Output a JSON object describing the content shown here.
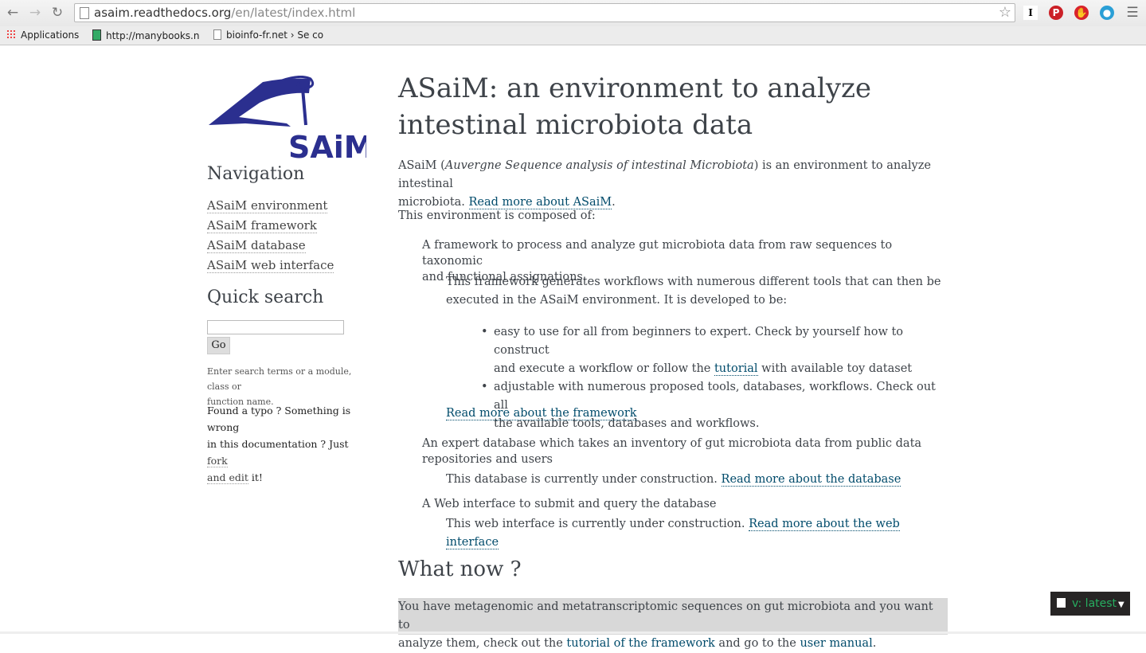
{
  "browser": {
    "url_host": "asaim.readthedocs.org",
    "url_path": "/en/latest/index.html",
    "bookmarks": [
      {
        "label": "Applications"
      },
      {
        "label": "http://manybooks.n"
      },
      {
        "label": "bioinfo-fr.net › Se co"
      }
    ]
  },
  "sidebar": {
    "logo_text": "SAiM",
    "nav_heading": "Navigation",
    "nav_items": [
      {
        "label": "ASaiM environment"
      },
      {
        "label": "ASaiM framework"
      },
      {
        "label": "ASaiM database"
      },
      {
        "label": "ASaiM web interface"
      }
    ],
    "qs_heading": "Quick search",
    "qs_input_value": "",
    "qs_button": "Go",
    "qs_help_1": "Enter search terms or a module, class or",
    "qs_help_2": "function name.",
    "typo_1": "Found a typo ? Something is wrong",
    "typo_2a": "in this documentation ? Just ",
    "typo_link_a": "fork",
    "typo_link_b": "and edit",
    "typo_end": " it!"
  },
  "main": {
    "title_1": "ASaiM: an environment to analyze",
    "title_2": "intestinal microbiota data",
    "intro_a": "ASaiM (",
    "intro_em": "Auvergne Sequence analysis of intestinal Microbiota",
    "intro_b": ") is an environment to analyze intestinal",
    "intro_c": "microbiota. ",
    "intro_link": "Read more about ASaiM",
    "intro_end": ".",
    "composed": "This environment is composed of:",
    "fw_term_1": "A framework to process and analyze gut microbiota data from raw sequences to taxonomic",
    "fw_term_2": "and functional assignations.",
    "fw_def_1": "This framework generates workflows with numerous different tools that can then be",
    "fw_def_2": "executed in the ASaiM environment. It is developed to be:",
    "bullet1_a": "easy to use for all from beginners to expert. Check by yourself how to construct",
    "bullet1_b": "and execute a workflow or follow the ",
    "bullet1_link": "tutorial",
    "bullet1_c": " with available toy dataset",
    "bullet2_a": "adjustable with numerous proposed tools, databases, workflows. Check out all",
    "bullet2_b": "the available tools, databases and workflows.",
    "fw_link": "Read more about the framework",
    "db_term_1": "An expert database which takes an inventory of gut microbiota data from public data",
    "db_term_2": "repositories and users",
    "db_def": "This database is currently under construction. ",
    "db_link": "Read more about the database",
    "web_term": "A Web interface to submit and query the database",
    "web_def": "This web interface is currently under construction. ",
    "web_link": "Read more about the web interface",
    "whatnow": "What now ?",
    "now_1": "You have metagenomic and metatranscriptomic sequences on gut microbiota and you want to",
    "now_2a": "analyze them, check out the ",
    "now_link1": "tutorial of the framework",
    "now_2b": " and go to the ",
    "now_link2": "user manual",
    "now_2c": "."
  },
  "version_badge": "v: latest"
}
